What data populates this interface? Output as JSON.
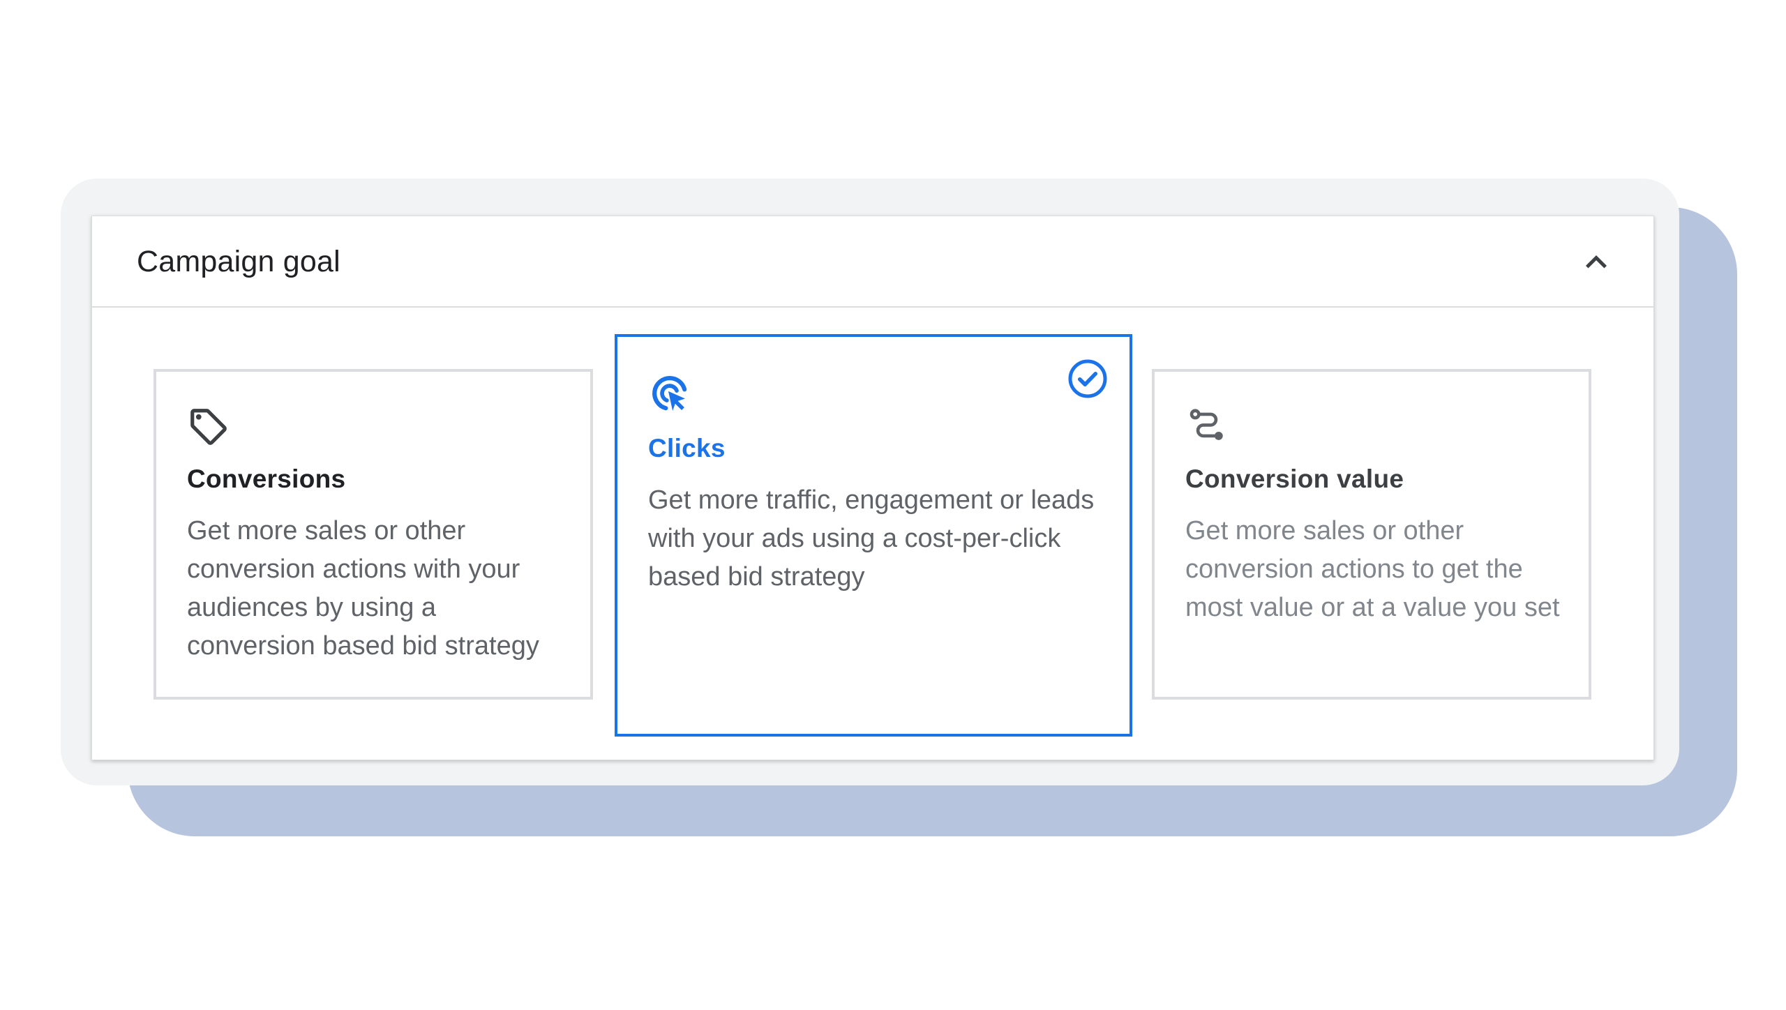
{
  "panel": {
    "title": "Campaign goal",
    "collapse_icon": "chevron-up-icon"
  },
  "goals": [
    {
      "icon": "tag-icon",
      "title": "Conversions",
      "description": "Get more sales or other conversion actions with your audiences by using a conversion based bid strategy",
      "selected": false
    },
    {
      "icon": "click-cursor-icon",
      "title": "Clicks",
      "description": "Get more traffic, engagement or leads with your ads using a cost-per-click based bid strategy",
      "selected": true
    },
    {
      "icon": "conversion-path-icon",
      "title": "Conversion value",
      "description": "Get more sales or other conversion actions to get the most value or at a value you set",
      "selected": false
    }
  ],
  "colors": {
    "accent": "#1a73e8",
    "border": "#dadce0",
    "backdrop": "#b6c4dd",
    "frame": "#f1f3f4",
    "text_primary": "#202124",
    "text_secondary": "#5f6368",
    "text_muted": "#80868b"
  }
}
